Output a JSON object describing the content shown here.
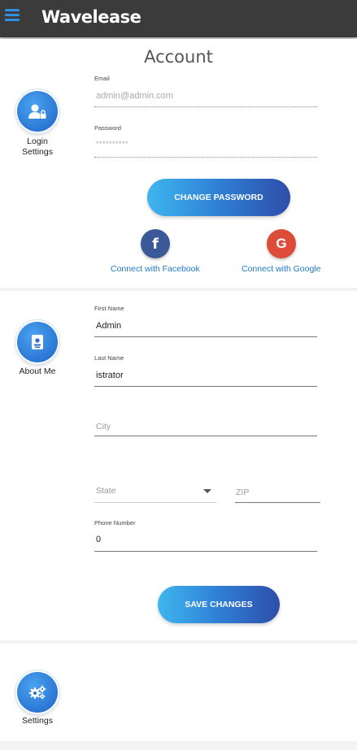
{
  "app": {
    "brand": "Wavelease"
  },
  "colors": {
    "topbar": "#3b3b3b",
    "accent": "#2f8fe0",
    "facebook": "#3b5998",
    "google": "#dd4b39",
    "link": "#1f7ac8"
  },
  "login": {
    "title": "Account",
    "section_label_line1": "Login",
    "section_label_line2": "Settings",
    "section_icon": "user-lock-icon",
    "email_label": "Email",
    "email_value": "admin@admin.com",
    "password_label": "Password",
    "password_value": "**********",
    "change_password_label": "CHANGE PASSWORD",
    "facebook_label": "Connect with Facebook",
    "facebook_icon": "f",
    "google_label": "Connect with Google",
    "google_icon": "G"
  },
  "about": {
    "section_label": "About Me",
    "section_icon": "id-badge-icon",
    "first_name_label": "First Name",
    "first_name_value": "Admin",
    "last_name_label": "Last Name",
    "last_name_value": "istrator",
    "city_placeholder": "City",
    "state_placeholder": "State",
    "zip_placeholder": "ZIP",
    "phone_label": "Phone Number",
    "phone_value": "0",
    "save_label": "SAVE CHANGES"
  },
  "settings": {
    "section_label": "Settings",
    "section_icon": "cogs-icon"
  }
}
